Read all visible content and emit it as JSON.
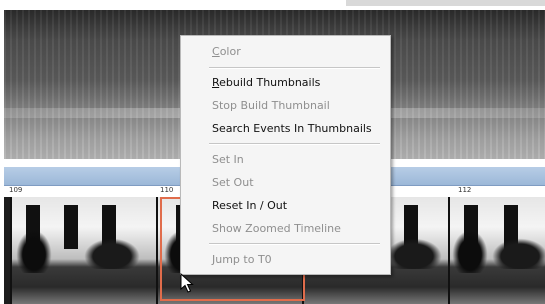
{
  "colors": {
    "timeline_bar": "#a9c2df",
    "selection_border": "#e06c4b",
    "menu_background": "#f5f5f5",
    "disabled_text": "#8f8f8f"
  },
  "timeline": {
    "ticks": [
      "109",
      "110",
      "112"
    ]
  },
  "context_menu": {
    "items": [
      {
        "label_mnemonic": "C",
        "label_rest": "olor",
        "enabled": false
      },
      {
        "label_mnemonic": "R",
        "label_rest": "ebuild Thumbnails",
        "enabled": true
      },
      {
        "label": "Stop Build Thumbnail",
        "enabled": false
      },
      {
        "label": "Search Events In Thumbnails",
        "enabled": true
      },
      {
        "label": "Set In",
        "enabled": false
      },
      {
        "label": "Set Out",
        "enabled": false
      },
      {
        "label": "Reset In / Out",
        "enabled": true
      },
      {
        "label": "Show Zoomed Timeline",
        "enabled": false
      },
      {
        "label": "Jump to T0",
        "enabled": false
      }
    ]
  },
  "icons": {
    "cursor": "mouse-pointer-icon"
  }
}
